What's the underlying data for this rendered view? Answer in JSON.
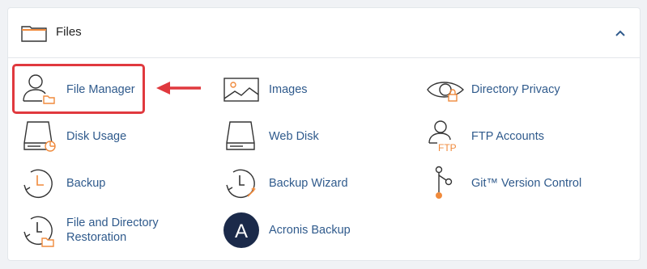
{
  "section": {
    "title": "Files",
    "items": [
      {
        "label": "File Manager",
        "icon": "file-manager-icon"
      },
      {
        "label": "Images",
        "icon": "images-icon"
      },
      {
        "label": "Directory Privacy",
        "icon": "directory-privacy-icon"
      },
      {
        "label": "Disk Usage",
        "icon": "disk-usage-icon"
      },
      {
        "label": "Web Disk",
        "icon": "web-disk-icon"
      },
      {
        "label": "FTP Accounts",
        "icon": "ftp-accounts-icon"
      },
      {
        "label": "Backup",
        "icon": "backup-icon"
      },
      {
        "label": "Backup Wizard",
        "icon": "backup-wizard-icon"
      },
      {
        "label": "Git™ Version Control",
        "icon": "git-version-control-icon"
      },
      {
        "label_line1": "File and Directory",
        "label_line2": "Restoration",
        "icon": "file-restoration-icon"
      },
      {
        "label": "Acronis Backup",
        "icon": "acronis-backup-icon"
      }
    ]
  },
  "ftp_icon_text": "FTP",
  "acronis_icon_text": "A",
  "colors": {
    "link": "#2f5a8c",
    "accent": "#f08a3c",
    "highlight": "#e0393e",
    "acronis": "#1b2a4a"
  }
}
